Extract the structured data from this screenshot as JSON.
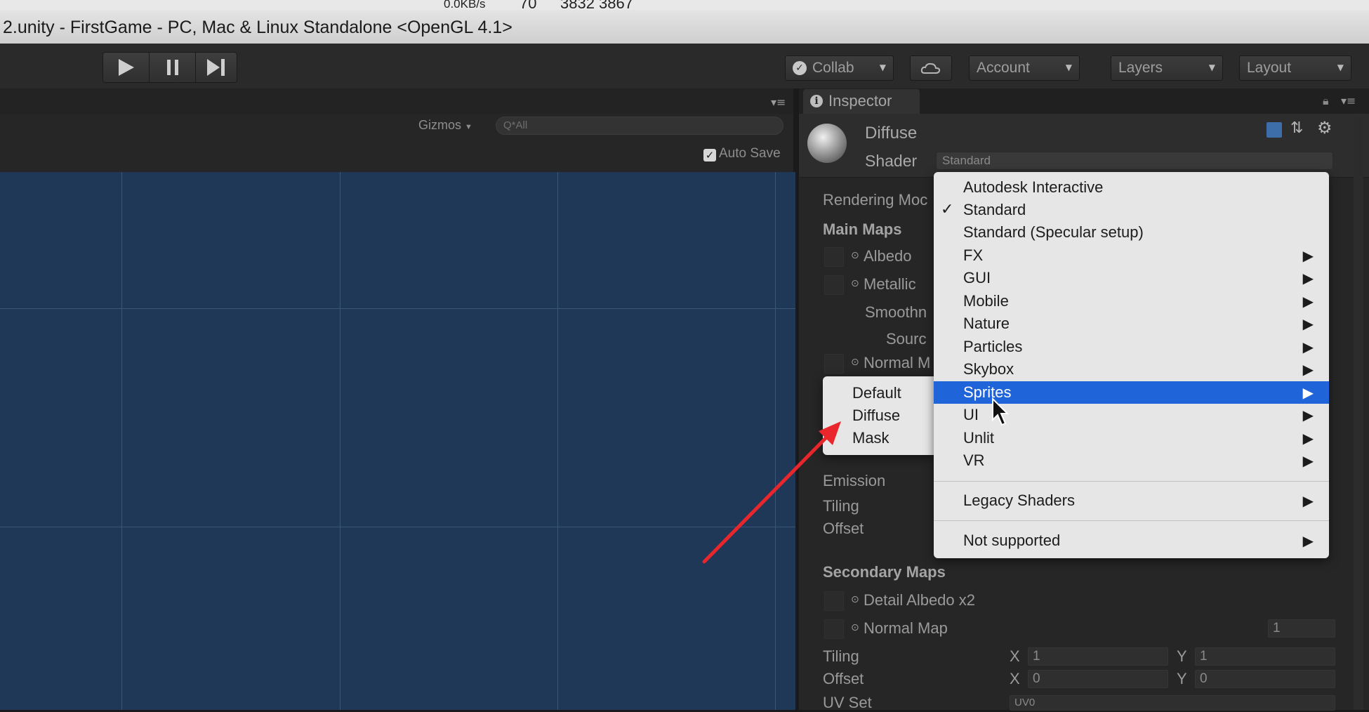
{
  "menubar": {
    "net_speed": "0.0KB/s",
    "fragment_1": "70",
    "fragment_2": "3832 3867"
  },
  "window": {
    "title": "2.unity - FirstGame - PC, Mac & Linux Standalone <OpenGL 4.1>"
  },
  "toolbar": {
    "play_icon": "play-icon",
    "pause_icon": "pause-icon",
    "step_icon": "step-icon",
    "collab_label": "Collab",
    "account_label": "Account",
    "layers_label": "Layers",
    "layout_label": "Layout"
  },
  "scene": {
    "gizmos_label": "Gizmos",
    "search_placeholder": "Q*All",
    "autosave_label": "Auto Save",
    "background_color": "#1f3858",
    "grid_color": "#3a5678"
  },
  "inspector": {
    "tab_label": "Inspector",
    "material_name": "Diffuse",
    "shader_label": "Shader",
    "shader_value": "Standard",
    "rendering_mode_label": "Rendering Moc",
    "main_maps_label": "Main Maps",
    "albedo_label": "Albedo",
    "metallic_label": "Metallic",
    "smoothness_label": "Smoothn",
    "source_label": "Sourc",
    "normal_map_label_main": "Normal M",
    "emission_label": "Emission",
    "tiling_label": "Tiling",
    "offset_label": "Offset",
    "secondary_maps_label": "Secondary Maps",
    "detail_albedo_label": "Detail Albedo x2",
    "normal_map_label": "Normal Map",
    "normal_map_value": "1",
    "sec_tiling_label": "Tiling",
    "sec_offset_label": "Offset",
    "uv_set_label": "UV Set",
    "uv_set_value": "UV0",
    "x_label": "X",
    "y_label": "Y",
    "sec_tiling_x": "1",
    "sec_tiling_y": "1",
    "sec_offset_x": "0",
    "sec_offset_y": "0"
  },
  "shader_menu": {
    "items": [
      {
        "label": "Autodesk Interactive"
      },
      {
        "label": "Standard",
        "checked": true
      },
      {
        "label": "Standard (Specular setup)"
      },
      {
        "label": "FX",
        "submenu": true
      },
      {
        "label": "GUI",
        "submenu": true
      },
      {
        "label": "Mobile",
        "submenu": true
      },
      {
        "label": "Nature",
        "submenu": true
      },
      {
        "label": "Particles",
        "submenu": true
      },
      {
        "label": "Skybox",
        "submenu": true
      },
      {
        "label": "Sprites",
        "submenu": true,
        "highlighted": true
      },
      {
        "label": "UI",
        "submenu": true
      },
      {
        "label": "Unlit",
        "submenu": true
      },
      {
        "label": "VR",
        "submenu": true
      }
    ],
    "legacy_label": "Legacy Shaders",
    "not_supported_label": "Not supported",
    "highlight_color": "#1f64d8"
  },
  "sprites_submenu": {
    "items": [
      "Default",
      "Diffuse",
      "Mask"
    ]
  },
  "annotation": {
    "arrow_color": "#e8262b"
  }
}
